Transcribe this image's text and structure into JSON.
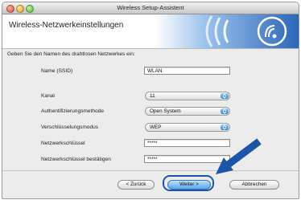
{
  "window": {
    "title": "Wireless Setup-Assistent"
  },
  "banner": {
    "title": "Wireless-Netzwerkeinstellungen"
  },
  "instruction": "Geben Sie den Namen des drahtlosen Netzwerkes ein:",
  "form": {
    "ssid": {
      "label": "Name (SSID)",
      "value": "WLAN"
    },
    "channel": {
      "label": "Kanal",
      "value": "11"
    },
    "auth": {
      "label": "Authentifizierungsmethode",
      "value": "Open System"
    },
    "encryption": {
      "label": "Verschlüsselungsmodus",
      "value": "WEP"
    },
    "key": {
      "label": "Netzwerkschlüssel",
      "value": "*****"
    },
    "key_confirm": {
      "label": "Netzwerkschlüssel bestätigen",
      "value": "*****"
    }
  },
  "buttons": {
    "back": "< Zurück",
    "next": "Weiter >",
    "cancel": "Abbrechen"
  },
  "colors": {
    "accent": "#1b55a8",
    "banner_blue": "#3a78c8",
    "default_button": "#5ba5ea"
  },
  "icons": [
    "wireless-signal-icon",
    "close-icon",
    "minimize-icon",
    "zoom-icon",
    "pointer-arrow-icon"
  ]
}
